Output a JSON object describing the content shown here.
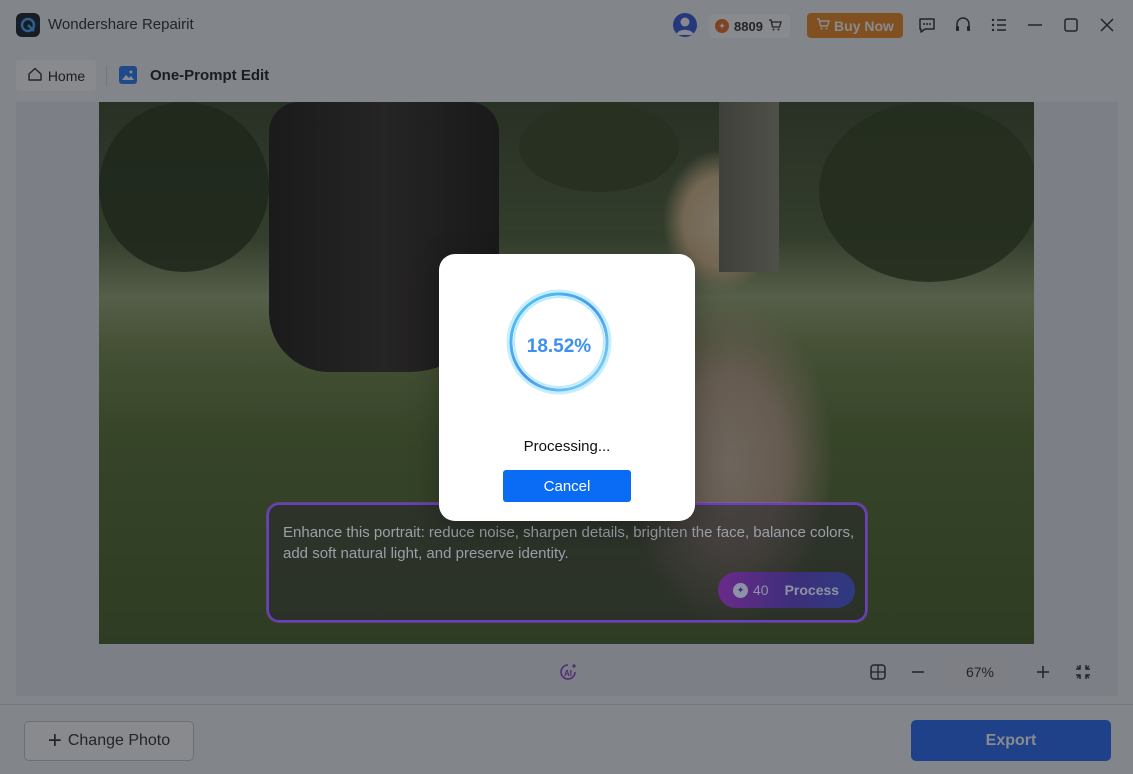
{
  "window": {
    "app_title": "Wondershare Repairit",
    "credits": "8809",
    "buy_label": "Buy Now"
  },
  "breadcrumb": {
    "home_label": "Home",
    "page_title": "One-Prompt Edit"
  },
  "prompt": {
    "text": "Enhance this portrait: reduce noise, sharpen details, brighten the face, balance colors, add soft natural light, and preserve identity.",
    "cost": "40",
    "process_label": "Process"
  },
  "toolbar": {
    "zoom": "67%"
  },
  "footer": {
    "change_photo_label": "Change Photo",
    "export_label": "Export"
  },
  "modal": {
    "progress": "18.52%",
    "status": "Processing...",
    "cancel_label": "Cancel"
  },
  "colors": {
    "accent": "#0a6cf5",
    "buy": "#f08a24",
    "progress": "#3d8ff0"
  }
}
